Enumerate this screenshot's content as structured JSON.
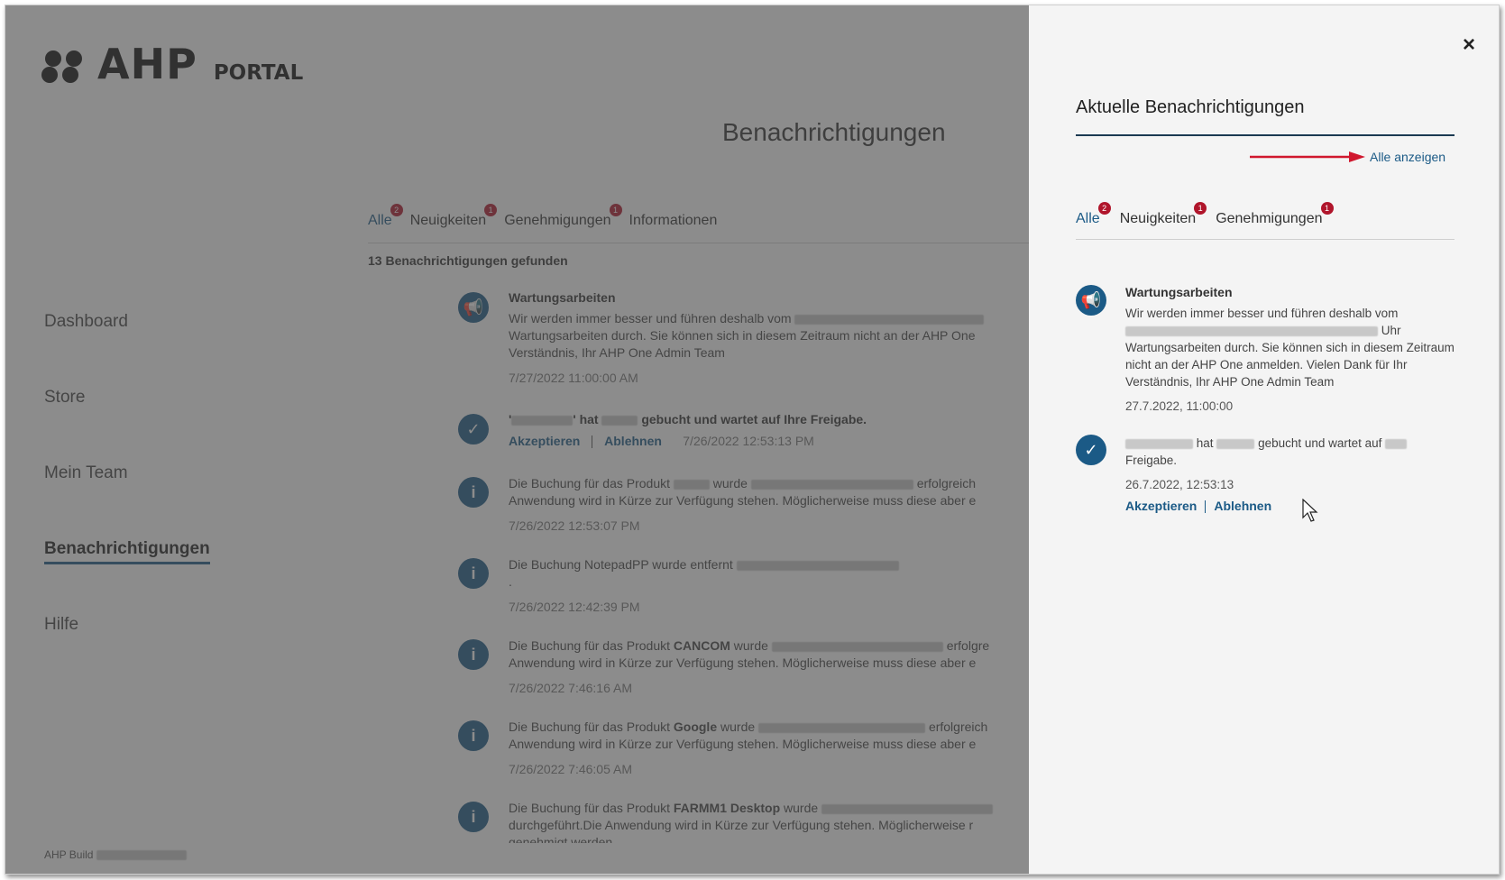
{
  "logo": {
    "brand": "AHP",
    "suffix": "PORTAL"
  },
  "page_title": "Benachrichtigungen",
  "sidebar": {
    "items": [
      {
        "label": "Dashboard"
      },
      {
        "label": "Store"
      },
      {
        "label": "Mein Team"
      },
      {
        "label": "Benachrichtigungen"
      },
      {
        "label": "Hilfe"
      }
    ],
    "build_label": "AHP Build"
  },
  "tabs": [
    {
      "label": "Alle",
      "badge": "2"
    },
    {
      "label": "Neuigkeiten",
      "badge": "1"
    },
    {
      "label": "Genehmigungen",
      "badge": "1"
    },
    {
      "label": "Informationen",
      "badge": ""
    }
  ],
  "found_text": "13 Benachrichtigungen gefunden",
  "bg_notifications": {
    "n1": {
      "title": "Wartungsarbeiten",
      "line1": "Wir werden immer besser und führen deshalb vom",
      "line2": "Wartungsarbeiten durch. Sie können sich in diesem Zeitraum nicht an der AHP One",
      "line3": "Verständnis, Ihr AHP One Admin Team",
      "date": "7/27/2022 11:00:00 AM"
    },
    "n2": {
      "part1": "'",
      "part2": "' hat",
      "part3": "gebucht und wartet auf Ihre Freigabe.",
      "accept": "Akzeptieren",
      "reject": "Ablehnen",
      "date": "7/26/2022 12:53:13 PM"
    },
    "n3": {
      "part1": "Die Buchung für das Produkt",
      "part2": "wurde",
      "part3": "erfolgreich",
      "line2": "Anwendung wird in Kürze zur Verfügung stehen. Möglicherweise muss diese aber e",
      "date": "7/26/2022 12:53:07 PM"
    },
    "n4": {
      "line1": "Die Buchung NotepadPP wurde entfernt",
      "line2": ".",
      "date": "7/26/2022 12:42:39 PM"
    },
    "n5": {
      "part1": "Die Buchung für das Produkt",
      "product": "CANCOM",
      "part2": "wurde",
      "part3": "erfolgre",
      "line2": "Anwendung wird in Kürze zur Verfügung stehen. Möglicherweise muss diese aber e",
      "date": "7/26/2022 7:46:16 AM"
    },
    "n6": {
      "part1": "Die Buchung für das Produkt",
      "product": "Google",
      "part2": "wurde",
      "part3": "erfolgreich",
      "line2": "Anwendung wird in Kürze zur Verfügung stehen. Möglicherweise muss diese aber e",
      "date": "7/26/2022 7:46:05 AM"
    },
    "n7": {
      "part1": "Die Buchung für das Produkt",
      "product": "FARMM1 Desktop",
      "part2": "wurde",
      "line2": "durchgeführt.Die Anwendung wird in Kürze zur Verfügung stehen. Möglicherweise r",
      "line3": "genehmigt werden"
    }
  },
  "panel": {
    "title": "Aktuelle Benachrichtigungen",
    "show_all": "Alle anzeigen",
    "tabs": [
      {
        "label": "Alle",
        "badge": "2"
      },
      {
        "label": "Neuigkeiten",
        "badge": "1"
      },
      {
        "label": "Genehmigungen",
        "badge": "1"
      }
    ],
    "items": {
      "maintenance": {
        "title": "Wartungsarbeiten",
        "line1": "Wir werden immer besser und führen deshalb vom",
        "uhr": "Uhr",
        "rest": "Wartungsarbeiten durch. Sie können sich in diesem Zeitraum nicht an der AHP One anmelden. Vielen Dank für Ihr Verständnis, Ihr AHP One Admin Team",
        "date": "27.7.2022, 11:00:00"
      },
      "approval": {
        "hat": "hat",
        "text": "gebucht und wartet auf",
        "line2": "Freigabe.",
        "date": "26.7.2022, 12:53:13",
        "accept": "Akzeptieren",
        "reject": "Ablehnen"
      }
    }
  },
  "close_label": "×",
  "colors": {
    "accent": "#1b5a86",
    "badge": "#b0152b",
    "arrow": "#d0182e"
  }
}
